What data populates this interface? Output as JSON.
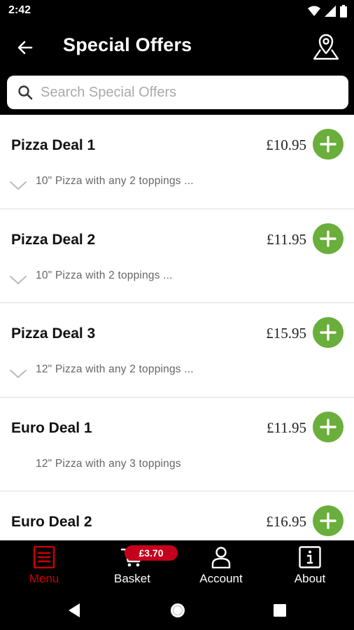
{
  "status_bar": {
    "time": "2:42"
  },
  "header": {
    "title": "Special Offers"
  },
  "search": {
    "placeholder": "Search Special Offers"
  },
  "offers": [
    {
      "name": "Pizza Deal 1",
      "price": "£10.95",
      "description": "10\" Pizza with any 2 toppings ..."
    },
    {
      "name": "Pizza Deal 2",
      "price": "£11.95",
      "description": "10\" Pizza with 2 toppings ..."
    },
    {
      "name": "Pizza Deal 3",
      "price": "£15.95",
      "description": "12\" Pizza with any 2 toppings ..."
    },
    {
      "name": "Euro Deal 1",
      "price": "£11.95",
      "description": "12\" Pizza with any 3 toppings"
    },
    {
      "name": "Euro Deal 2",
      "price": "£16.95",
      "description": ""
    }
  ],
  "bottom_nav": {
    "menu": "Menu",
    "basket": "Basket",
    "basket_total": "£3.70",
    "account": "Account",
    "about": "About"
  },
  "colors": {
    "accent_green": "#6aae3b",
    "active_red": "#cc0000",
    "badge_red": "#c4001d"
  }
}
